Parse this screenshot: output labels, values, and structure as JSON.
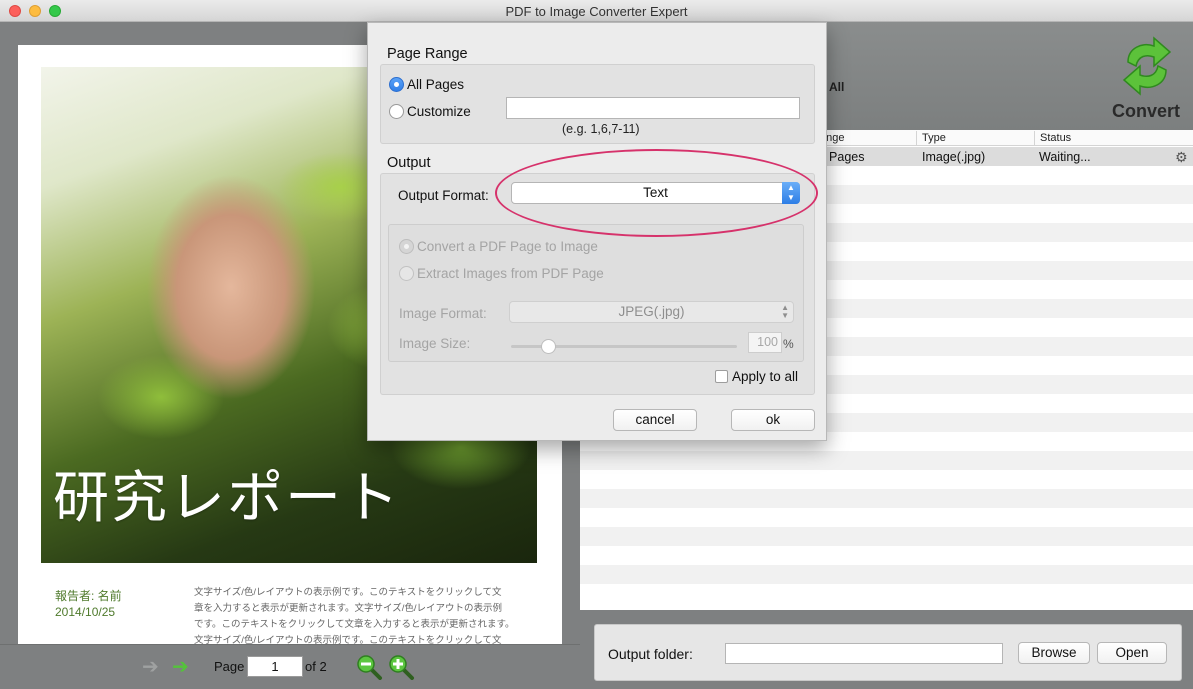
{
  "window": {
    "title": "PDF to Image Converter Expert"
  },
  "preview": {
    "photo_title": "研究レポート",
    "reporter_line": "報告者: 名前",
    "date_line": "2014/10/25",
    "body_lines": [
      "文字サイズ/色/レイアウトの表示例です。このテキストをクリックして文",
      "章を入力すると表示が更新されます。文字サイズ/色/レイアウトの表示例",
      "です。このテキストをクリックして文章を入力すると表示が更新されます。",
      "文字サイズ/色/レイアウトの表示例です。このテキストをクリックして文"
    ],
    "nav": {
      "page_label": "Page",
      "page_value": "1",
      "of_label": "of 2"
    }
  },
  "toolbar": {
    "all_label": "All",
    "convert_label": "Convert"
  },
  "table": {
    "columns": [
      "ange",
      "Type",
      "Status"
    ],
    "rows": [
      {
        "range": "ll Pages",
        "type": "Image(.jpg)",
        "status": "Waiting..."
      }
    ]
  },
  "output": {
    "folder_label": "Output folder:",
    "folder_value": "",
    "browse_label": "Browse",
    "open_label": "Open"
  },
  "dialog": {
    "page_range_title": "Page Range",
    "all_pages_label": "All Pages",
    "customize_label": "Customize",
    "customize_value": "",
    "customize_hint": "(e.g. 1,6,7-11)",
    "output_title": "Output",
    "output_format_label": "Output Format:",
    "output_format_value": "Text",
    "convert_to_image_label": "Convert a PDF Page to Image",
    "extract_images_label": "Extract Images from PDF Page",
    "image_format_label": "Image Format:",
    "image_format_value": "JPEG(.jpg)",
    "image_size_label": "Image Size:",
    "image_size_value": "100",
    "image_size_unit": "%",
    "image_size_fraction": 0.17,
    "apply_all_label": "Apply to all",
    "cancel_label": "cancel",
    "ok_label": "ok"
  },
  "colors": {
    "accent_blue": "#2f7fe8",
    "highlight_ellipse": "#d6326b",
    "nav_forward": "#54c33a"
  }
}
